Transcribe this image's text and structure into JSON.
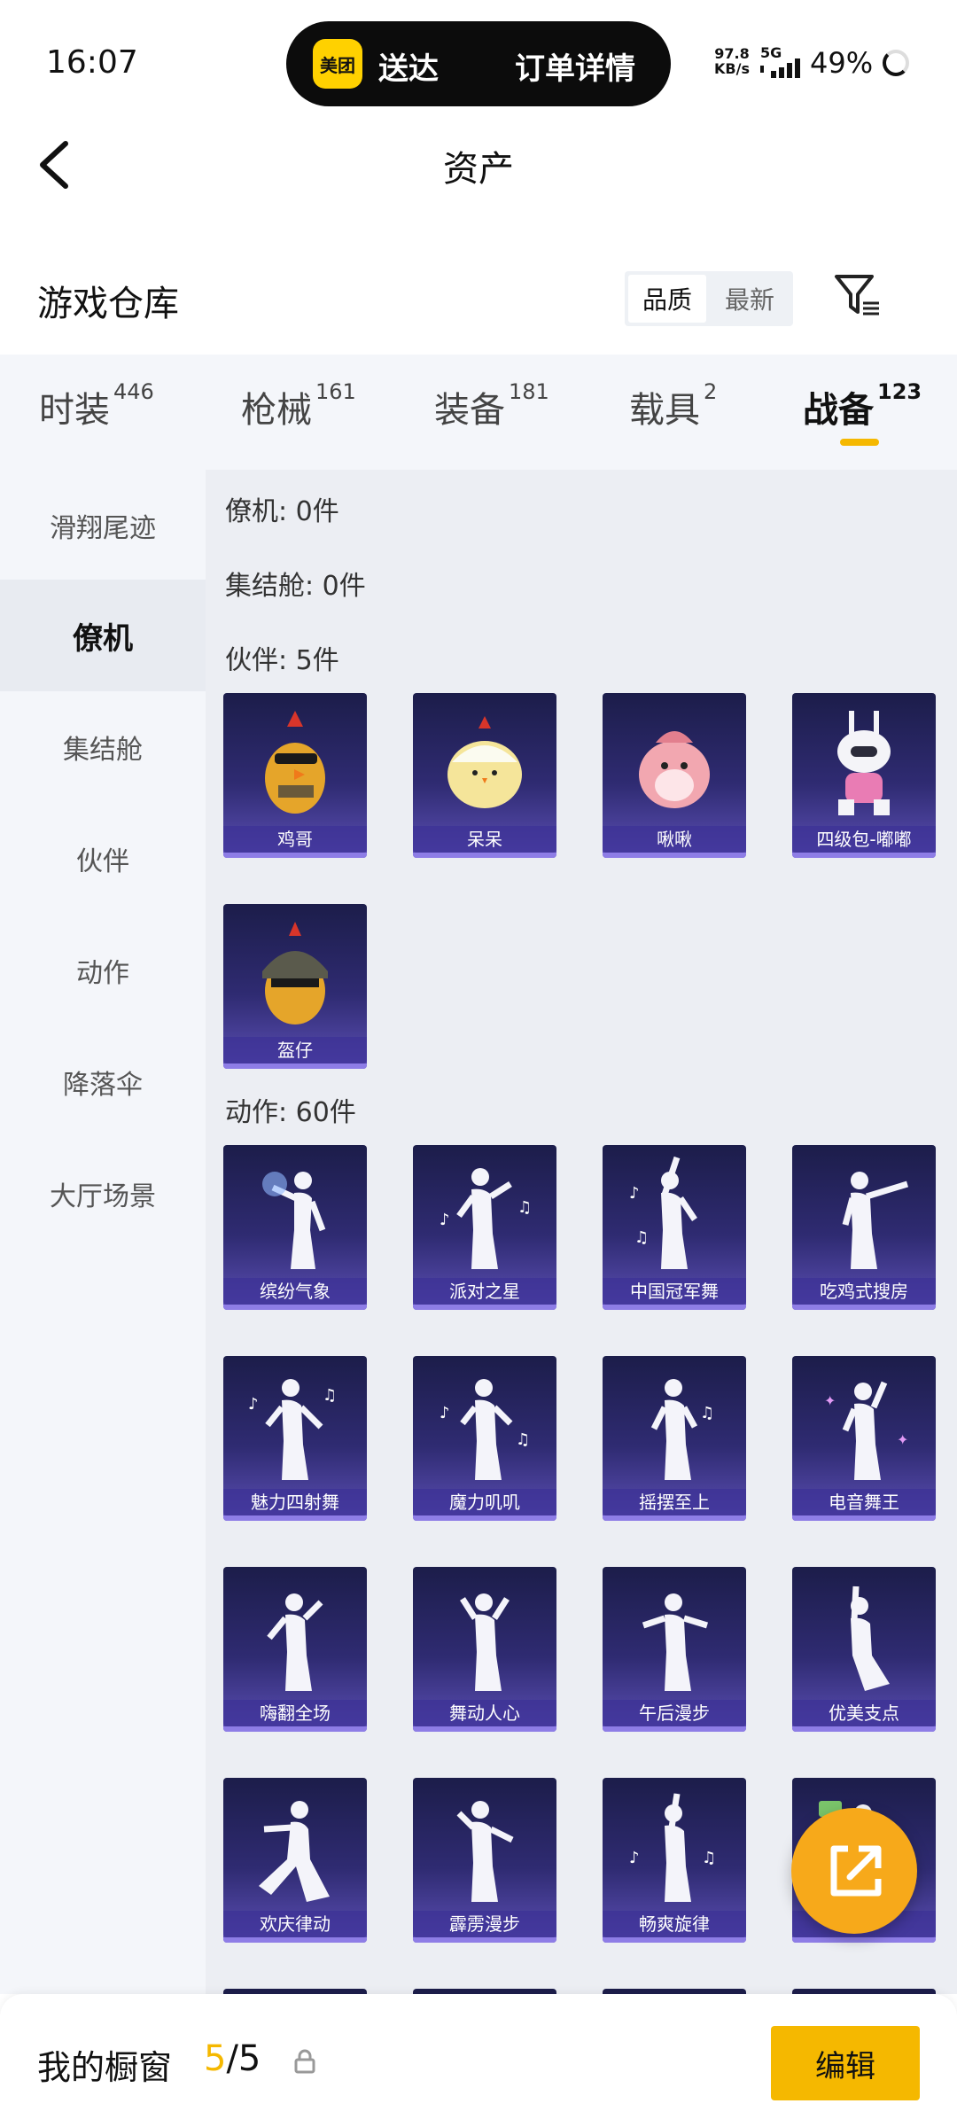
{
  "status_bar": {
    "time": "16:07",
    "island_logo": "美团",
    "island_left": "送达",
    "island_right": "订单详情",
    "net_speed_value": "97.8",
    "net_speed_unit": "KB/s",
    "network": "5G",
    "battery": "49%"
  },
  "header": {
    "title": "资产",
    "back_icon": "chevron-left-icon"
  },
  "section": {
    "title": "游戏仓库",
    "sort_options": [
      "品质",
      "最新"
    ],
    "sort_selected": "品质",
    "filter_icon": "filter-icon"
  },
  "tabs": [
    {
      "label": "时装",
      "count": "446"
    },
    {
      "label": "枪械",
      "count": "161"
    },
    {
      "label": "装备",
      "count": "181"
    },
    {
      "label": "载具",
      "count": "2"
    },
    {
      "label": "战备",
      "count": "123",
      "active": true
    }
  ],
  "sidebar": {
    "items": [
      "滑翔尾迹",
      "僚机",
      "集结舱",
      "伙伴",
      "动作",
      "降落伞",
      "大厅场景"
    ],
    "active": "僚机"
  },
  "content": {
    "groups": [
      {
        "title": "僚机: 0件",
        "items": []
      },
      {
        "title": "集结舱: 0件",
        "items": []
      },
      {
        "title": "伙伴: 5件",
        "items": [
          "鸡哥",
          "呆呆",
          "啾啾",
          "四级包-嘟嘟",
          "盔仔"
        ]
      },
      {
        "title": "动作: 60件",
        "items": [
          "缤纷气象",
          "派对之星",
          "中国冠军舞",
          "吃鸡式搜房",
          "魅力四射舞",
          "魔力叽叽",
          "摇摆至上",
          "电音舞王",
          "嗨翻全场",
          "舞动人心",
          "午后漫步",
          "优美支点",
          "欢庆律动",
          "霹雳漫步",
          "畅爽旋律",
          "…"
        ]
      }
    ]
  },
  "bottom_bar": {
    "showcase_label": "我的橱窗",
    "showcase_current": "5",
    "showcase_total": "/5",
    "lock_icon": "lock-icon",
    "edit_label": "编辑"
  },
  "share_icon": "share-external-icon",
  "colors": {
    "accent": "#f5b800",
    "card_top": "#1c1d4a",
    "card_bottom": "#5c4fb5",
    "fab": "#f7a91a"
  }
}
